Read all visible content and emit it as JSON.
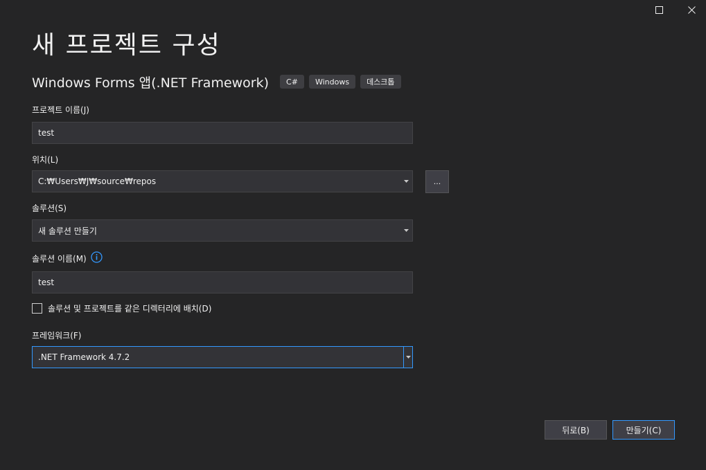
{
  "window": {
    "maximize_icon": "maximize-icon",
    "close_icon": "close-icon"
  },
  "page_title": "새 프로젝트 구성",
  "template": {
    "name": "Windows Forms 앱(.NET Framework)",
    "tags": [
      "C#",
      "Windows",
      "데스크톱"
    ]
  },
  "project_name": {
    "label": "프로젝트 이름(J)",
    "value": "test"
  },
  "location": {
    "label": "위치(L)",
    "value": "C:₩Users₩J₩source₩repos",
    "browse_label": "..."
  },
  "solution": {
    "label": "솔루션(S)",
    "value": "새 솔루션 만들기"
  },
  "solution_name": {
    "label": "솔루션 이름(M)",
    "info_icon": "info-icon",
    "value": "test"
  },
  "same_directory": {
    "label": "솔루션 및 프로젝트를 같은 디렉터리에 배치(D)",
    "checked": false
  },
  "framework": {
    "label": "프레임워크(F)",
    "value": ".NET Framework 4.7.2"
  },
  "buttons": {
    "back": "뒤로(B)",
    "create": "만들기(C)"
  },
  "colors": {
    "background": "#252526",
    "input_bg": "#333337",
    "accent": "#3399ff",
    "tag_bg": "#3e3e42"
  }
}
